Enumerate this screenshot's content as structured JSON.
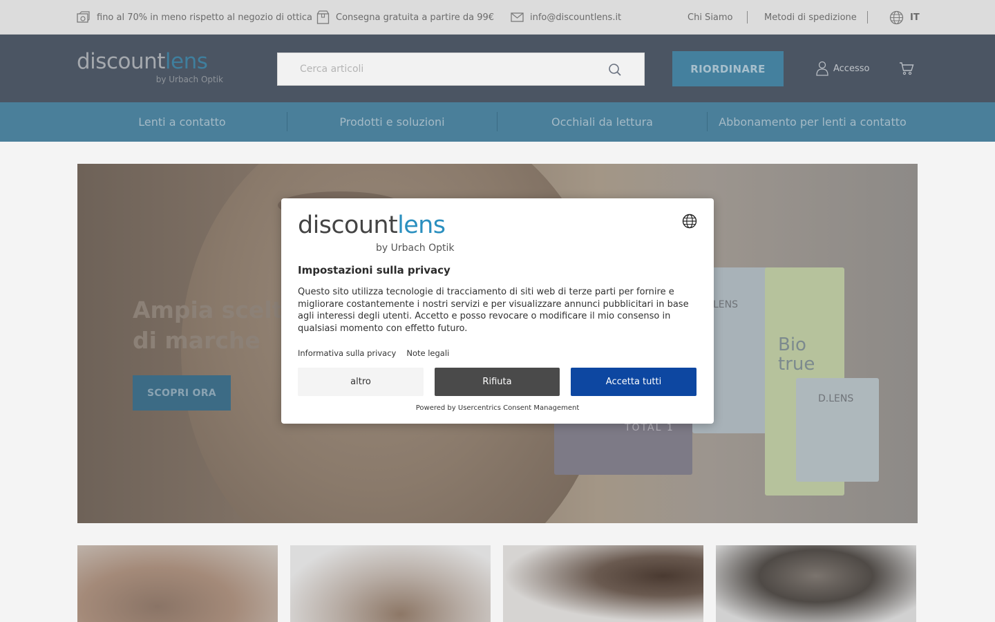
{
  "topbar": {
    "promo": "fino al 70% in meno rispetto al negozio di ottica",
    "shipping": "Consegna gratuita a partire da 99€",
    "email": "info@discountlens.it",
    "about": "Chi Siamo",
    "shipping_methods": "Metodi di spedizione",
    "language": "IT"
  },
  "header": {
    "logo_main": "discount",
    "logo_accent": "lens",
    "logo_sub": "by Urbach Optik",
    "search_placeholder": "Cerca articoli",
    "reorder_label": "RIORDINARE",
    "login_label": "Accesso"
  },
  "nav": {
    "tabs": [
      {
        "label": "Lenti a contatto"
      },
      {
        "label": "Prodotti e soluzioni"
      },
      {
        "label": "Occhiali da lettura"
      },
      {
        "label": "Abbonamento per lenti a contatto"
      }
    ]
  },
  "hero": {
    "title": "Ampia scelta di marche",
    "cta": "SCOPRI ORA",
    "product_labels": [
      "LENS",
      "Bio true",
      "D.LENS",
      "TOTAL 1"
    ]
  },
  "consent": {
    "logo_main": "discount",
    "logo_accent": "lens",
    "logo_sub": "by Urbach Optik",
    "title": "Impostazioni sulla privacy",
    "text": "Questo sito utilizza tecnologie di tracciamento di siti web di terze parti per fornire e migliorare costantemente i nostri servizi e per visualizzare annunci pubblicitari in base agli interessi degli utenti. Accetto e posso revocare o modificare il mio consenso in qualsiasi momento con effetto futuro.",
    "link_privacy": "Informativa sulla privacy",
    "link_legal": "Note legali",
    "btn_more": "altro",
    "btn_deny": "Rifiuta",
    "btn_accept": "Accetta tutti",
    "powered": "Powered by Usercentrics Consent Management"
  },
  "colors": {
    "brand_blue": "#2a8fbf",
    "accept_blue": "#0d47a1",
    "deny_gray": "#4a4a4a",
    "header_bg": "#4b5563",
    "nav_bg": "#4a7f9a"
  }
}
